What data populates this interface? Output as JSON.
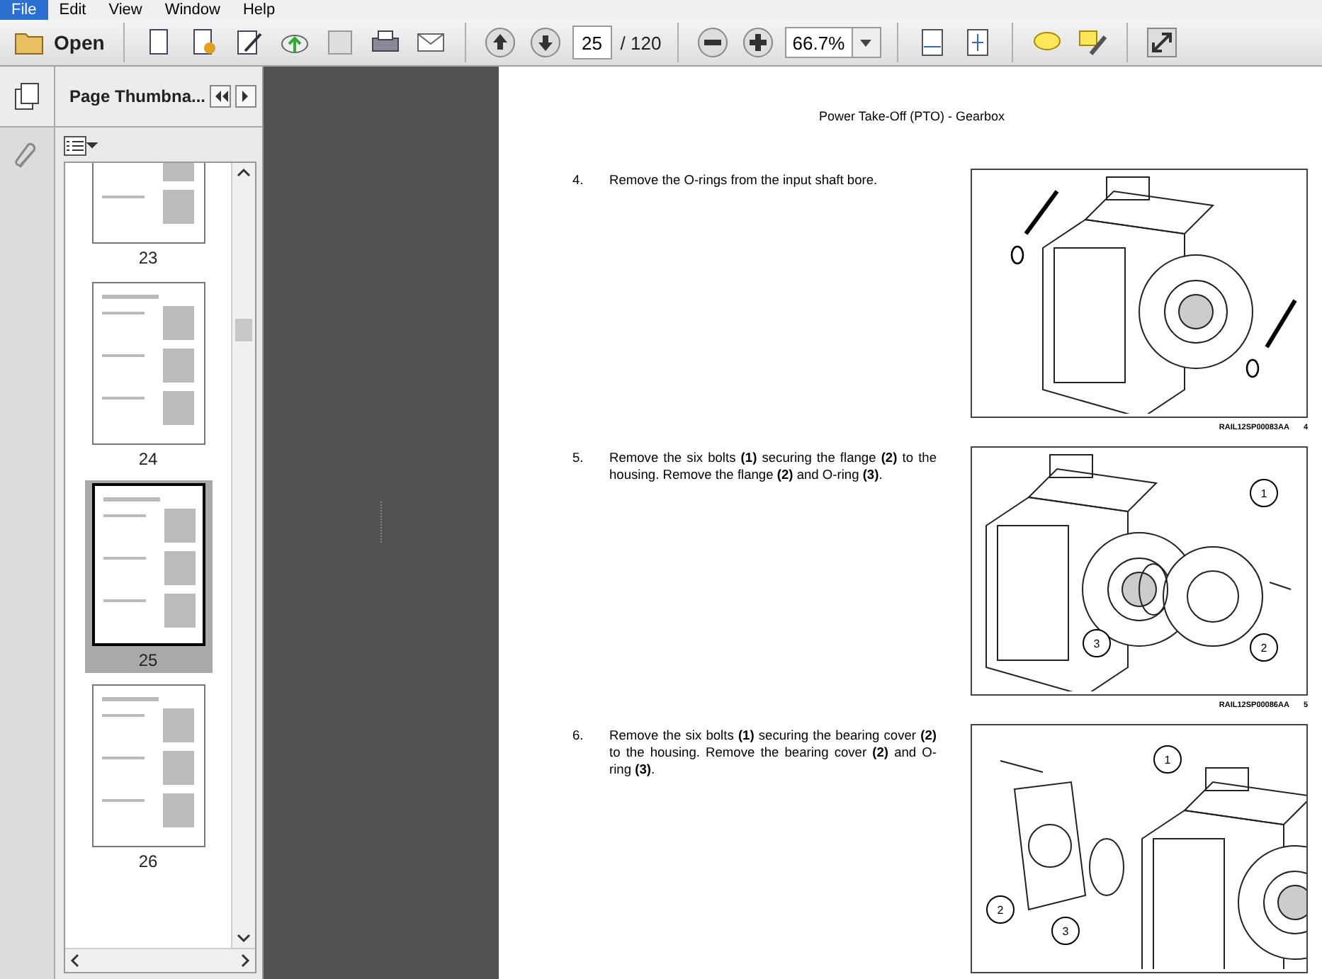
{
  "menu": [
    {
      "label": "File",
      "selected": true
    },
    {
      "label": "Edit",
      "selected": false
    },
    {
      "label": "View",
      "selected": false
    },
    {
      "label": "Window",
      "selected": false
    },
    {
      "label": "Help",
      "selected": false
    }
  ],
  "toolbar": {
    "open_label": "Open",
    "page_number": "25",
    "page_total": "/ 120",
    "zoom": "66.7%"
  },
  "thumbnails_panel": {
    "title": "Page Thumbna...",
    "pages": [
      {
        "label": "23",
        "selected": false
      },
      {
        "label": "24",
        "selected": false
      },
      {
        "label": "25",
        "selected": true
      },
      {
        "label": "26",
        "selected": false
      }
    ]
  },
  "document": {
    "header": "Power Take-Off (PTO) - Gearbox",
    "steps": [
      {
        "number": "4.",
        "text": "Remove the O-rings from the input shaft bore.",
        "figure": {
          "kind": "orings",
          "code": "RAIL12SP00083AA",
          "index": "4"
        }
      },
      {
        "number": "5.",
        "text": "Remove the six bolts **(1)** securing the flange **(2)** to the housing. Remove the flange **(2)** and O-ring **(3)**.",
        "figure": {
          "kind": "flange",
          "code": "RAIL12SP00086AA",
          "index": "5",
          "callouts": [
            "1",
            "2",
            "3"
          ]
        }
      },
      {
        "number": "6.",
        "text": "Remove the six bolts **(1)** securing the bearing cover **(2)** to the housing.  Remove the bearing cover **(2)** and O-ring **(3)**.",
        "figure": {
          "kind": "cover",
          "callouts": [
            "1",
            "2",
            "3"
          ]
        }
      }
    ]
  }
}
